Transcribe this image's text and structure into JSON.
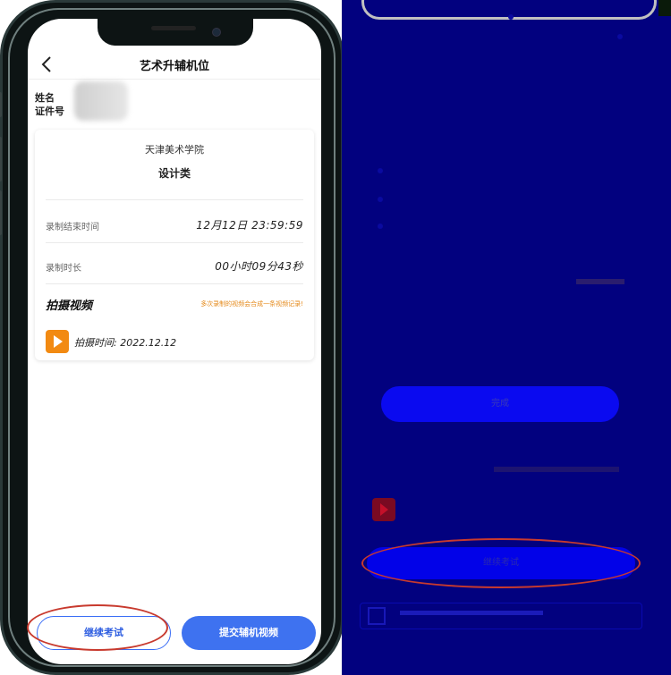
{
  "left_phone": {
    "nav_title": "艺术升辅机位",
    "name_label": "姓名",
    "id_label": "证件号",
    "card": {
      "school": "天津美术学院",
      "category": "设计类",
      "end_time_label": "录制结束时间",
      "end_time_value": "12月12日 23:59:59",
      "duration_label": "录制时长",
      "duration_value": "00小时09分43秒",
      "section_title": "拍摄视频",
      "section_hint": "多次录制的视频会合成一条视频记录!",
      "video_time": "拍摄时间: 2022.12.12"
    },
    "continue_button": "继续考试",
    "submit_button": "提交辅机视频"
  },
  "right_phone": {
    "button_1": "完成",
    "button_2": "继续考试"
  },
  "colors": {
    "accent_blue": "#3e72f0",
    "hint_orange": "#e58a1b",
    "video_icon": "#f28a12",
    "highlight_red": "#c83a2e",
    "right_screen_bg": "#02017f"
  },
  "icons": [
    "back-icon",
    "video-play-icon",
    "qr-code-icon"
  ]
}
